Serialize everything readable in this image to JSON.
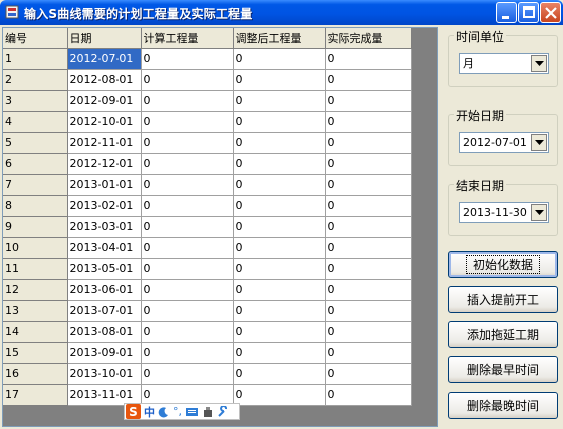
{
  "window": {
    "title": "输入S曲线需要的计划工程量及实际工程量"
  },
  "grid": {
    "columns": [
      "编号",
      "日期",
      "计算工程量",
      "调整后工程量",
      "实际完成量"
    ],
    "rows": [
      [
        "1",
        "2012-07-01",
        "0",
        "0",
        "0"
      ],
      [
        "2",
        "2012-08-01",
        "0",
        "0",
        "0"
      ],
      [
        "3",
        "2012-09-01",
        "0",
        "0",
        "0"
      ],
      [
        "4",
        "2012-10-01",
        "0",
        "0",
        "0"
      ],
      [
        "5",
        "2012-11-01",
        "0",
        "0",
        "0"
      ],
      [
        "6",
        "2012-12-01",
        "0",
        "0",
        "0"
      ],
      [
        "7",
        "2013-01-01",
        "0",
        "0",
        "0"
      ],
      [
        "8",
        "2013-02-01",
        "0",
        "0",
        "0"
      ],
      [
        "9",
        "2013-03-01",
        "0",
        "0",
        "0"
      ],
      [
        "10",
        "2013-04-01",
        "0",
        "0",
        "0"
      ],
      [
        "11",
        "2013-05-01",
        "0",
        "0",
        "0"
      ],
      [
        "12",
        "2013-06-01",
        "0",
        "0",
        "0"
      ],
      [
        "13",
        "2013-07-01",
        "0",
        "0",
        "0"
      ],
      [
        "14",
        "2013-08-01",
        "0",
        "0",
        "0"
      ],
      [
        "15",
        "2013-09-01",
        "0",
        "0",
        "0"
      ],
      [
        "16",
        "2013-10-01",
        "0",
        "0",
        "0"
      ],
      [
        "17",
        "2013-11-01",
        "0",
        "0",
        "0"
      ]
    ]
  },
  "ime": {
    "logo": "S",
    "mode": "中"
  },
  "panel": {
    "time_unit": {
      "label": "时间单位",
      "value": "月"
    },
    "start_date": {
      "label": "开始日期",
      "value": "2012-07-01"
    },
    "end_date": {
      "label": "结束日期",
      "value": "2013-11-30"
    },
    "buttons": {
      "init": "初始化数据",
      "insert_early": "插入提前开工",
      "add_delay": "添加拖延工期",
      "delete_earliest": "删除最早时间",
      "delete_latest": "删除最晚时间"
    }
  }
}
